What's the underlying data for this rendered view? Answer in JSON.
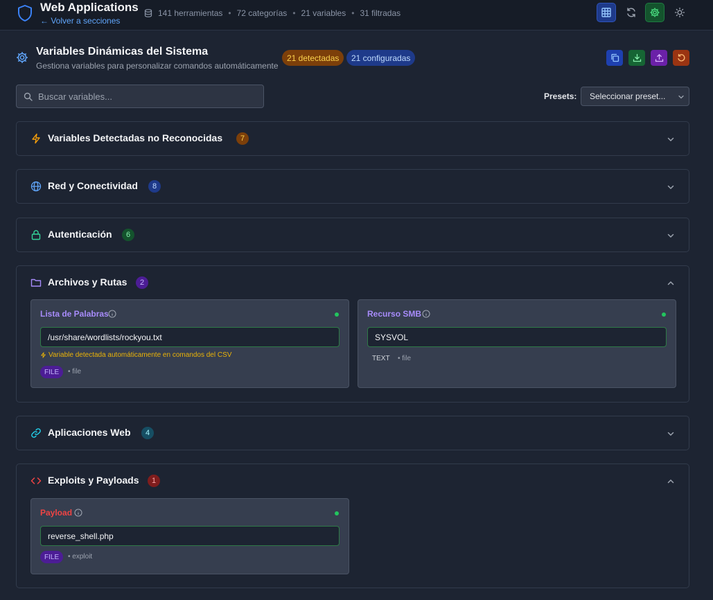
{
  "app": {
    "title": "Web Applications",
    "back_label": "Volver a secciones",
    "stats": {
      "tools": "141 herramientas",
      "categories": "72 categorías",
      "variables": "21 variables",
      "filtered": "31 filtradas"
    }
  },
  "toolbar_icons": [
    "grid-icon",
    "refresh-icon",
    "gear-icon",
    "sun-icon"
  ],
  "header": {
    "title": "Variables Dinámicas del Sistema",
    "subtitle": "Gestiona variables para personalizar comandos automáticamente",
    "detected_badge": "21 detectadas",
    "configured_badge": "21 configuradas",
    "actions": [
      "copy-icon",
      "download-icon",
      "upload-icon",
      "reset-icon"
    ]
  },
  "search": {
    "placeholder": "Buscar variables...",
    "value": ""
  },
  "presets": {
    "label": "Presets:",
    "selected": "Seleccionar preset..."
  },
  "sections": [
    {
      "title": "Variables Detectadas no Reconocidas",
      "count": "7",
      "icon": "lightning-icon",
      "color": "#f59e0b",
      "expanded": false
    },
    {
      "title": "Red y Conectividad",
      "count": "8",
      "icon": "globe-icon",
      "color": "#60a5fa",
      "expanded": false
    },
    {
      "title": "Autenticación",
      "count": "6",
      "icon": "lock-icon",
      "color": "#34d399",
      "expanded": false
    },
    {
      "title": "Archivos y Rutas",
      "count": "2",
      "icon": "folder-icon",
      "color": "#a78bfa",
      "expanded": true,
      "cards": [
        {
          "label": "Lista de Palabras",
          "value": "/usr/share/wordlists/rockyou.txt",
          "note": "Variable detectada automáticamente en comandos del CSV",
          "type": "FILE",
          "category": "file"
        },
        {
          "label": "Recurso SMB",
          "value": "SYSVOL",
          "type": "TEXT",
          "category": "file"
        }
      ]
    },
    {
      "title": "Aplicaciones Web",
      "count": "4",
      "icon": "link-icon",
      "color": "#22d3ee",
      "expanded": false
    },
    {
      "title": "Exploits y Payloads",
      "count": "1",
      "icon": "code-icon",
      "color": "#ef4444",
      "expanded": true,
      "cards": [
        {
          "label": "Payload",
          "value": "reverse_shell.php",
          "type": "FILE",
          "category": "exploit"
        }
      ]
    }
  ]
}
